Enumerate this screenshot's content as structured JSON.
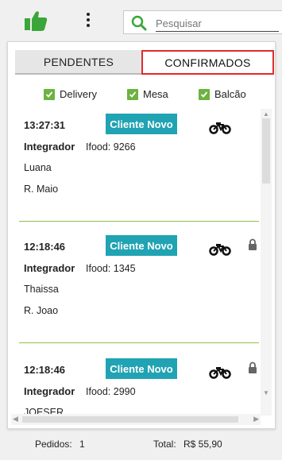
{
  "toolbar": {
    "search_placeholder": "Pesquisar",
    "search_value": ""
  },
  "tabs": [
    {
      "label": "PENDENTES",
      "active": false
    },
    {
      "label": "CONFIRMADOS",
      "active": true
    }
  ],
  "filters": [
    {
      "label": "Delivery",
      "checked": true
    },
    {
      "label": "Mesa",
      "checked": true
    },
    {
      "label": "Balcão",
      "checked": true
    }
  ],
  "orders": [
    {
      "time": "13:27:31",
      "badge": "Cliente Novo",
      "integrator_label": "Integrador",
      "integrator_value": "Ifood: 9266",
      "name": "Luana",
      "address": "R. Maio",
      "locked": false
    },
    {
      "time": "12:18:46",
      "badge": "Cliente Novo",
      "integrator_label": "Integrador",
      "integrator_value": "Ifood: 1345",
      "name": "Thaissa",
      "address": "R. Joao",
      "locked": true
    },
    {
      "time": "12:18:46",
      "badge": "Cliente Novo",
      "integrator_label": "Integrador",
      "integrator_value": "Ifood: 2990",
      "name": "JOESER",
      "address": "",
      "locked": true
    }
  ],
  "footer": {
    "pedidos_label": "Pedidos:",
    "pedidos_value": "1",
    "total_label": "Total:",
    "total_value": "R$ 55,90"
  },
  "colors": {
    "accent_green": "#6cb33f",
    "badge": "#20a3b3",
    "active_tab_border": "#e02b2b",
    "separator": "#8bc34a"
  }
}
